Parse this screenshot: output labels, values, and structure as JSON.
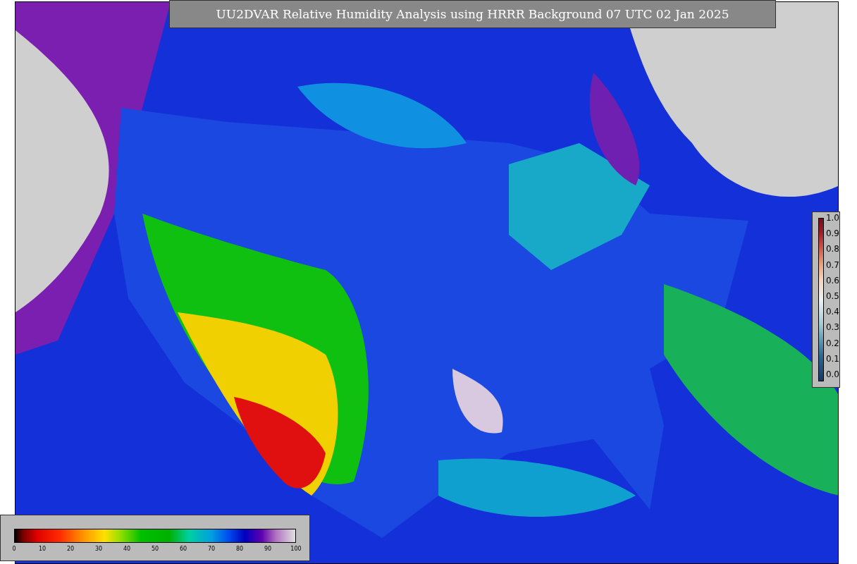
{
  "title": "UU2DVAR Relative Humidity Analysis using HRRR Background 07 UTC 02 Jan 2025",
  "side_colorbar": {
    "ticks": [
      "1.0",
      "0.9",
      "0.8",
      "0.7",
      "0.6",
      "0.5",
      "0.4",
      "0.3",
      "0.2",
      "0.1",
      "0.0"
    ]
  },
  "bottom_colorbar": {
    "ticks": [
      "0",
      "10",
      "20",
      "30",
      "40",
      "50",
      "60",
      "70",
      "80",
      "90",
      "100"
    ]
  }
}
